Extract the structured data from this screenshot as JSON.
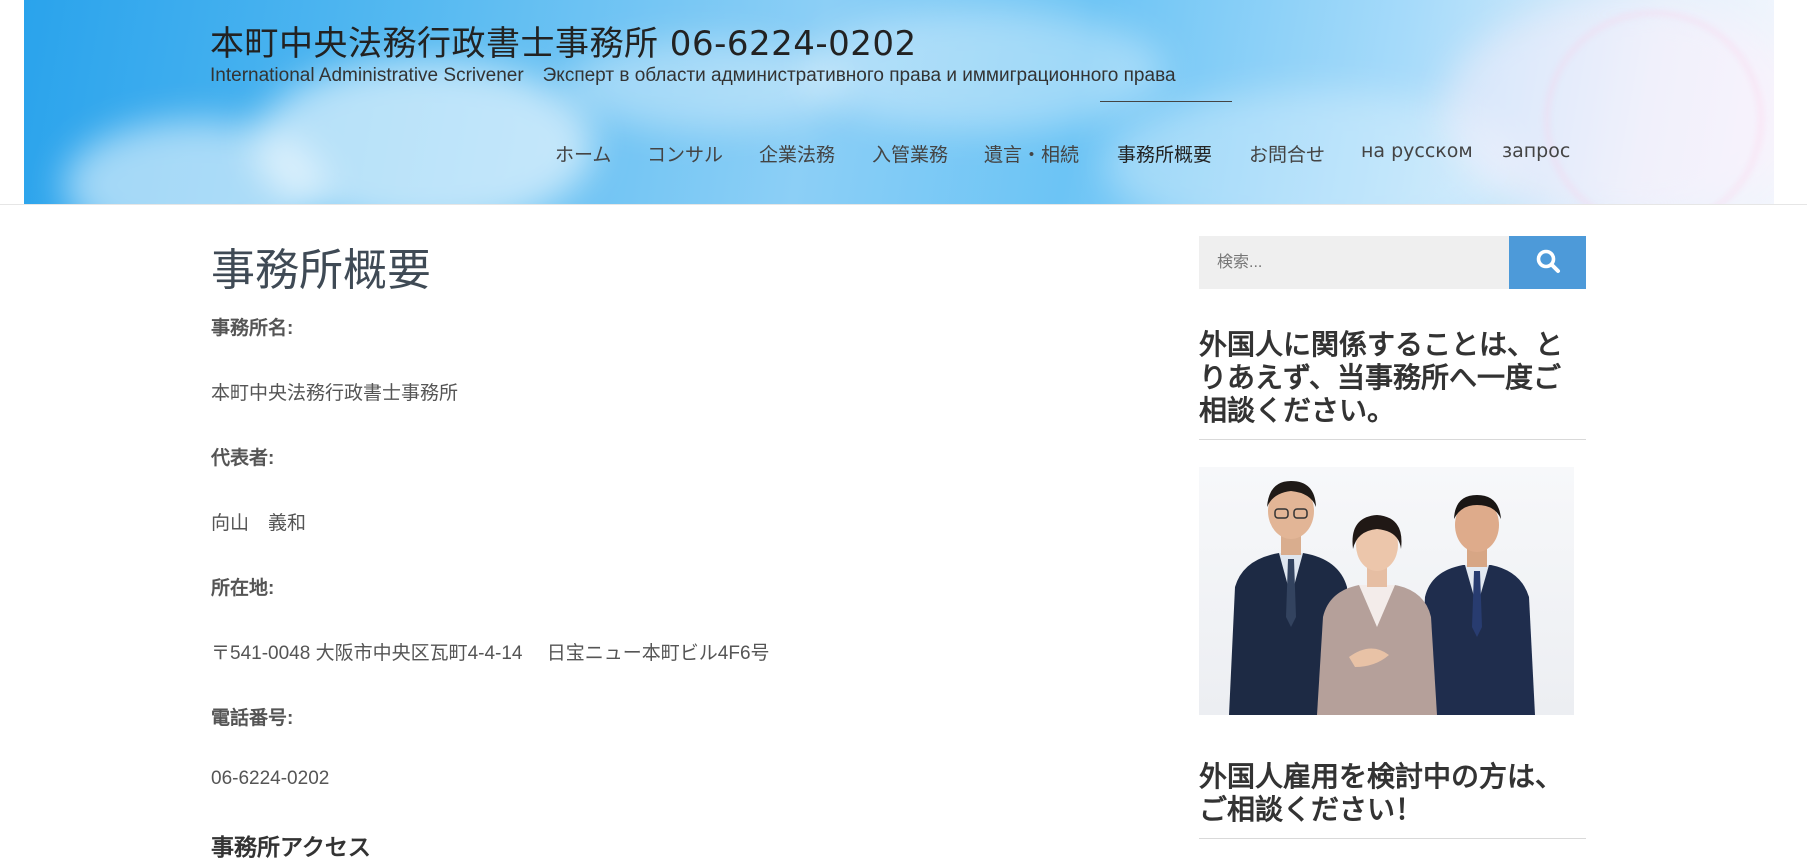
{
  "header": {
    "site_title": "本町中央法務行政書士事務所 06-6224-0202",
    "tagline": "International Administrative Scrivener　Эксперт в области административного права и иммиграционного права"
  },
  "nav": {
    "items": [
      {
        "label": "ホーム"
      },
      {
        "label": "コンサル"
      },
      {
        "label": "企業法務"
      },
      {
        "label": "入管業務"
      },
      {
        "label": "遺言・相続"
      },
      {
        "label": "事務所概要"
      },
      {
        "label": "お問合せ"
      },
      {
        "label": "на русском"
      },
      {
        "label": "запрос"
      }
    ],
    "current": "事務所概要"
  },
  "main": {
    "page_title": "事務所概要",
    "fields": [
      {
        "label": "事務所名:",
        "value": "本町中央法務行政書士事務所"
      },
      {
        "label": "代表者:",
        "value": "向山　義和"
      },
      {
        "label": "所在地:",
        "value": "〒541-0048  大阪市中央区瓦町4-4-14　 日宝ニュー本町ビル4F6号"
      },
      {
        "label": "電話番号:",
        "value": "06-6224-0202"
      }
    ],
    "access_heading": "事務所アクセス"
  },
  "sidebar": {
    "search_placeholder": "検索...",
    "search_icon": "search-icon",
    "widget1_title": "外国人に関係することは、とりあえず、当事務所へ一度ご相談ください。",
    "widget2_title": "外国人雇用を検討中の方は、ご相談ください！"
  },
  "colors": {
    "accent": "#4d9ad9",
    "text": "#444444",
    "search_bg": "#efefef"
  }
}
